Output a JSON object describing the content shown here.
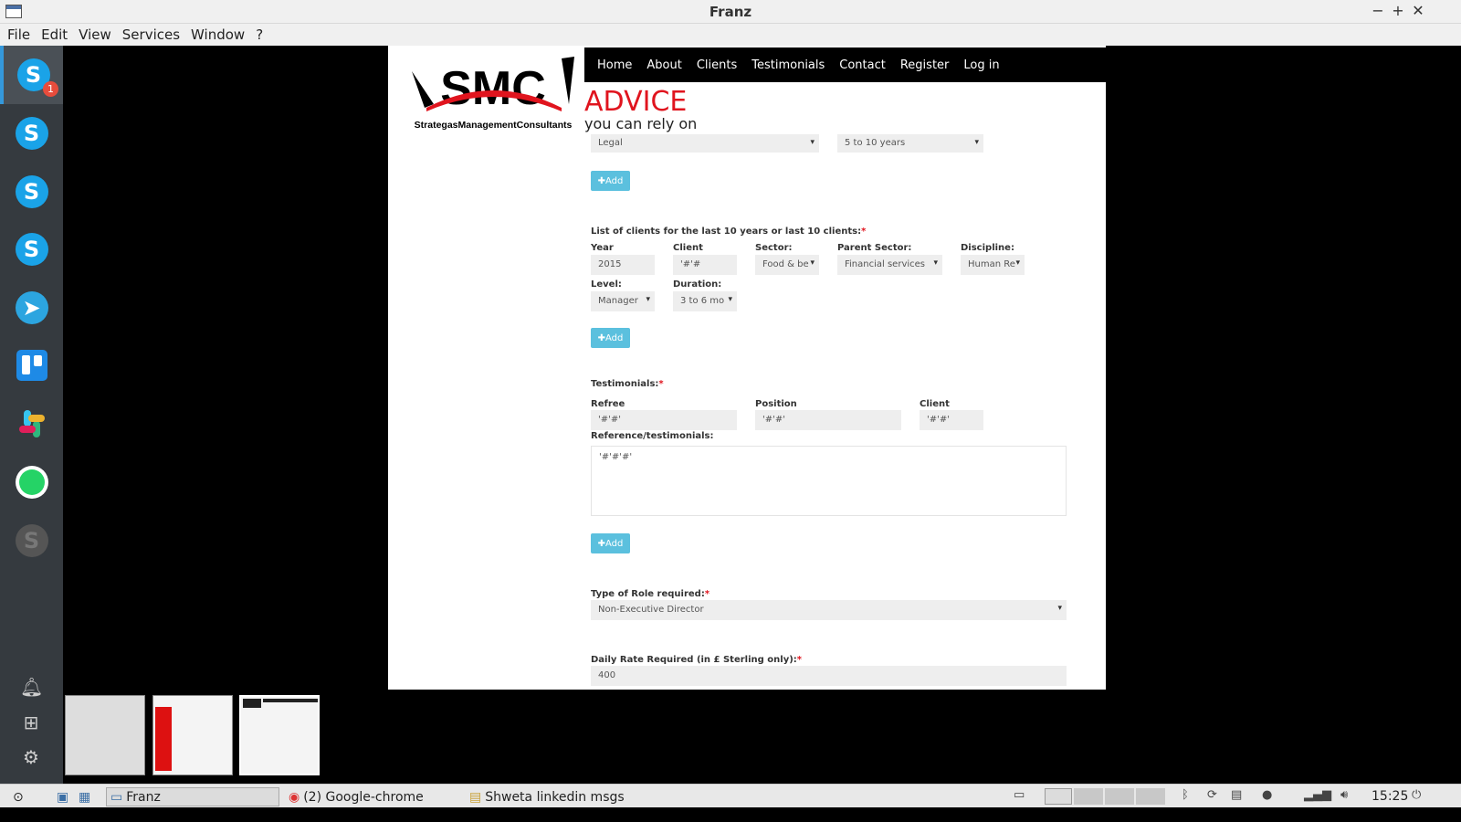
{
  "window": {
    "title": "Franz",
    "minimize": "−",
    "maximize": "+",
    "close": "✕"
  },
  "menu": [
    "File",
    "Edit",
    "View",
    "Services",
    "Window",
    "?"
  ],
  "sidebar": {
    "badge": "1",
    "services": [
      "skype-icon",
      "skype-icon",
      "skype-icon",
      "skype-icon",
      "telegram-icon",
      "trello-icon",
      "slack-icon",
      "whatsapp-icon",
      "skype-icon"
    ]
  },
  "site": {
    "logo_text": "SMC",
    "logo_sub": "StrategasManagementConsultants",
    "nav": [
      "Home",
      "About",
      "Clients",
      "Testimonials",
      "Contact",
      "Register",
      "Log in"
    ],
    "advice": "ADVICE",
    "rely": "you can rely on"
  },
  "form": {
    "top_select_1": "Legal",
    "top_select_2": "5 to 10 years",
    "add_label": "Add",
    "clients_heading": "List of clients for the last 10 years or last 10 clients:",
    "year_label": "Year",
    "year_value": "2015",
    "client_label": "Client",
    "client_value": "'#'#",
    "sector_label": "Sector:",
    "sector_value": "Food & be",
    "parent_sector_label": "Parent Sector:",
    "parent_sector_value": "Financial services",
    "discipline_label": "Discipline:",
    "discipline_value": "Human Re",
    "level_label": "Level:",
    "level_value": "Manager",
    "duration_label": "Duration:",
    "duration_value": "3 to 6 mo",
    "testimonials_heading": "Testimonials:",
    "refree_label": "Refree",
    "refree_value": "'#'#'",
    "position_label": "Position",
    "position_value": "'#'#'",
    "t_client_label": "Client",
    "t_client_value": "'#'#'",
    "reference_label": "Reference/testimonials:",
    "reference_value": "'#'#'#'",
    "role_heading": "Type of Role required:",
    "role_value": "Non-Executive Director",
    "rate_heading": "Daily Rate Required (in £ Sterling only):",
    "rate_value": "400"
  },
  "taskbar": {
    "items": [
      "Franz",
      "(2) Google-chrome",
      "Shweta linkedin msgs"
    ],
    "clock": "15:25"
  },
  "colors": {
    "accent_red": "#e0141e",
    "add_button": "#5bc0de",
    "sidebar": "#353a3f"
  }
}
